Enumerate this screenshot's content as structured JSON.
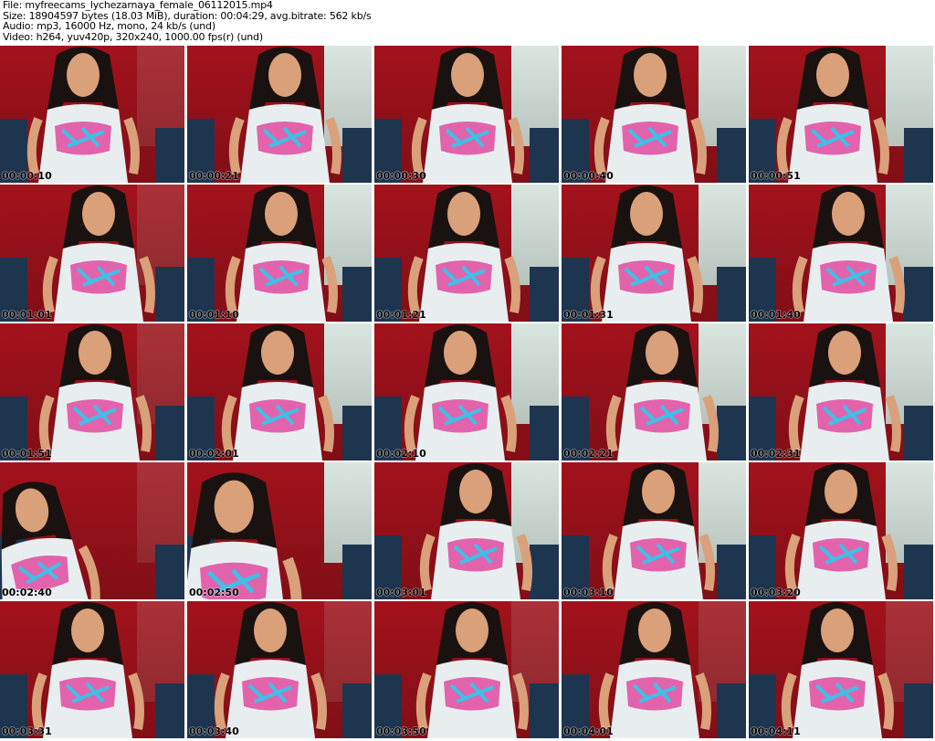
{
  "header": {
    "file": "File: myfreecams_lychezarnaya_female_06112015.mp4",
    "size": "Size: 18904597 bytes (18.03 MiB), duration: 00:04:29, avg.bitrate: 562 kb/s",
    "audio": "Audio: mp3, 16000 Hz, mono, 24 kb/s (und)",
    "video": "Video: h264, yuv420p, 320x240, 1000.00 fps(r) (und)"
  },
  "thumbnails": [
    {
      "time": "00:00:10"
    },
    {
      "time": "00:00:21"
    },
    {
      "time": "00:00:30"
    },
    {
      "time": "00:00:40"
    },
    {
      "time": "00:00:51"
    },
    {
      "time": "00:01:01"
    },
    {
      "time": "00:01:10"
    },
    {
      "time": "00:01:21"
    },
    {
      "time": "00:01:31"
    },
    {
      "time": "00:01:40"
    },
    {
      "time": "00:01:51"
    },
    {
      "time": "00:02:01"
    },
    {
      "time": "00:02:10"
    },
    {
      "time": "00:02:21"
    },
    {
      "time": "00:02:31"
    },
    {
      "time": "00:02:40"
    },
    {
      "time": "00:02:50"
    },
    {
      "time": "00:03:01"
    },
    {
      "time": "00:03:10"
    },
    {
      "time": "00:03:20"
    },
    {
      "time": "00:03:31"
    },
    {
      "time": "00:03:40"
    },
    {
      "time": "00:03:50"
    },
    {
      "time": "00:04:01"
    },
    {
      "time": "00:04:11"
    }
  ],
  "colors": {
    "background": "#ffffff",
    "chair_red": "#a3121c",
    "wall": "#d9e6e0",
    "shirt": "#e8eef0",
    "skin": "#d9a07a",
    "hair": "#1a1210"
  }
}
